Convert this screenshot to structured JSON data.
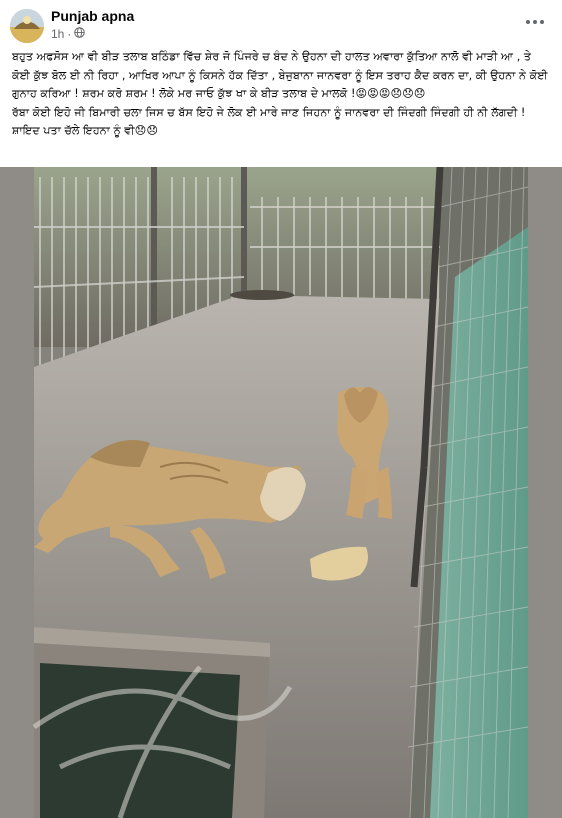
{
  "post": {
    "author": "Punjab apna",
    "time": "1h",
    "visibility_icon": "globe-icon",
    "more_icon": "more-horizontal-icon",
    "text": "ਬਹੁਤ ਅਫਸੋਸ ਆ ਵੀ ਬੀੜ ਤਲਾਬ ਬਠਿੰਡਾ ਵਿੱਚ ਸ਼ੇਰ ਜੋ ਪਿੰਜਰੇ ਚ ਬੰਦ ਨੇ ਉਹਨਾ ਦੀ ਹਾਲਤ ਅਵਾਰਾ ਕੁੱਤਿਆ ਨਾਲੋ ਵੀ ਮਾੜੀ ਆ , ਤੇ ਕੋਈ ਕੁੱਝ ਬੋਲ ਈ ਨੀ ਰਿਹਾ , ਆਖਿਰ ਆਪਾ ਨੂੰ ਕਿਸਨੇ ਹੱਕ ਦਿੱਤਾ , ਬੇਜੁਬਾਨਾ ਜਾਨਵਰਾ ਨੂੰ ਇਸ ਤਰਾਹ ਕੈਦ ਕਰਨ ਦਾ, ਕੀ ਉਹਨਾ ਨੇ ਕੋਈ ਗੁਨਾਹ ਕਰਿਆ ! ਸ਼ਰਮ ਕਰੋ ਸ਼ਰਮ ! ਲੋਕੇ ਮਰ ਜਾਓ ਕੁੱਝ ਖਾ ਕੇ ਬੀੜ ਤਲਾਬ ਦੇ ਮਾਲਕੋ !😡😡😡😞😞😞\nਰੱਬਾ ਕੋਈ ਇਹੋ ਜੀ ਬਿਮਾਰੀ ਚਲਾ ਜਿਸ ਚ ਬੱਸ ਇਹੋ ਜੇ ਲੋਕ ਈ ਮਾਰੇ ਜਾਣ ਜਿਹਨਾ ਨੂੰ ਜਾਨਵਰਾ ਦੀ ਜਿੰਦਗੀ ਜਿੰਦਗੀ ਹੀ ਨੀ ਲੱਗਦੀ ! ਸ਼ਾਇਦ ਪਤਾ ਚੱਲੇ ਇਹਨਾ ਨੂੰ ਵੀ😞😞"
  },
  "photo": {
    "subject": "two emaciated lions in a cage"
  }
}
